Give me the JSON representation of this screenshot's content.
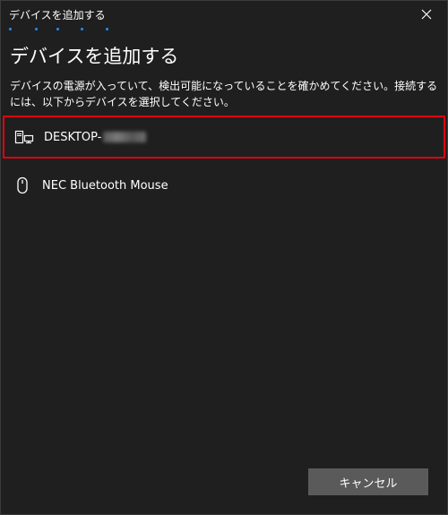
{
  "window": {
    "title": "デバイスを追加する"
  },
  "page": {
    "heading": "デバイスを追加する",
    "description": "デバイスの電源が入っていて、検出可能になっていることを確かめてください。接続するには、以下からデバイスを選択してください。"
  },
  "devices": [
    {
      "name": "DESKTOP-",
      "icon": "computer-icon",
      "selected": true
    },
    {
      "name": "NEC Bluetooth Mouse",
      "icon": "mouse-icon",
      "selected": false
    }
  ],
  "buttons": {
    "cancel_label": "キャンセル"
  },
  "colors": {
    "background": "#1f1f1f",
    "selection_border": "#e0000f",
    "progress_accent": "#1e90ff",
    "button_bg": "#5a5a5a"
  }
}
